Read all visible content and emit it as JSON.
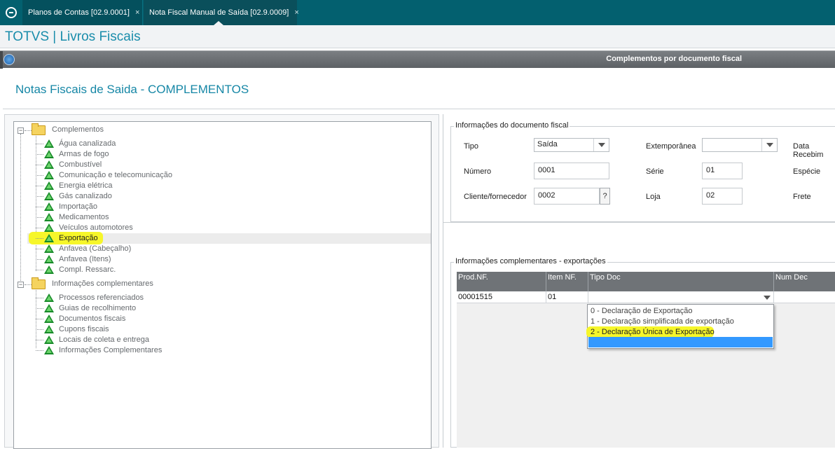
{
  "tabs": [
    {
      "label": "Planos de Contas [02.9.0001]",
      "close": "×"
    },
    {
      "label": "Nota Fiscal Manual de Saída [02.9.0009]",
      "close": "×"
    }
  ],
  "app": {
    "title": "TOTVS | Livros Fiscais"
  },
  "dialog": {
    "title": "Complementos por documento fiscal"
  },
  "page": {
    "title": "Notas Fiscais de Saida - COMPLEMENTOS"
  },
  "tree": {
    "groups": [
      {
        "label": "Complementos",
        "items": [
          "Água canalizada",
          "Armas de fogo",
          "Combustível",
          "Comunicação e telecomunicação",
          "Energia elétrica",
          "Gás canalizado",
          "Importação",
          "Medicamentos",
          "Veículos automotores",
          "Exportação",
          "Anfavea (Cabeçalho)",
          "Anfavea (Itens)",
          "Compl. Ressarc."
        ]
      },
      {
        "label": "Informações complementares",
        "items": [
          "Processos referenciados",
          "Guias de recolhimento",
          "Documentos fiscais",
          "Cupons fiscais",
          "Locais de coleta e entrega",
          "Informações Complementares"
        ]
      }
    ],
    "selected": "Exportação"
  },
  "docinfo": {
    "legend": "Informações do documento fiscal",
    "tipo_label": "Tipo",
    "tipo_value": "Saída",
    "extemporanea_label": "Extemporânea",
    "extemporanea_value": "",
    "data_receb_label": "Data Recebim",
    "numero_label": "Número",
    "numero_value": "0001",
    "serie_label": "Série",
    "serie_value": "01",
    "especie_label": "Espécie",
    "cliente_label": "Cliente/fornecedor",
    "cliente_value": "0002",
    "lookup": "?",
    "loja_label": "Loja",
    "loja_value": "02",
    "frete_label": "Frete"
  },
  "export": {
    "legend": "Informações complementares - exportações",
    "columns": [
      "Prod.NF.",
      "Item NF.",
      "Tipo Doc",
      "Num Dec"
    ],
    "row": {
      "prod": "00001515",
      "item": "01",
      "tipo": "",
      "num": ""
    },
    "options": [
      "0 - Declaração de Exportação",
      "1 - Declaração simplificada de exportação",
      "2 - Declaração Única de Exportação"
    ],
    "highlighted_option": "2 - Declaração Única de Exportação"
  },
  "colors": {
    "topbar": "#03606f",
    "accent": "#1a8dab",
    "tree_icon": "#168a28",
    "highlight": "#f6f62a",
    "selection": "#3399ff"
  }
}
